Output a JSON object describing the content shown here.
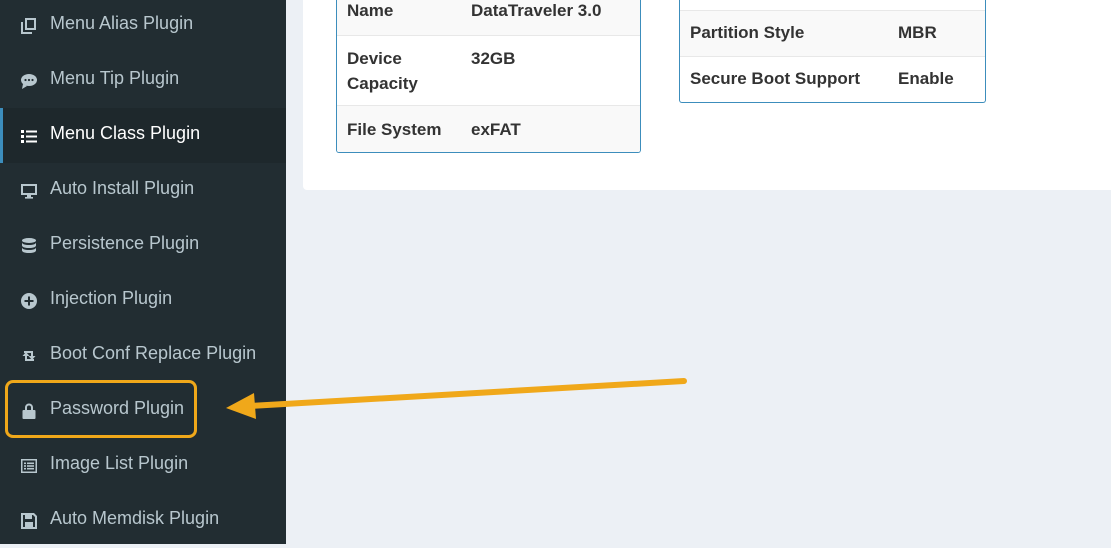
{
  "sidebar": {
    "items": [
      {
        "label": "Menu Alias Plugin",
        "icon": "copy-icon"
      },
      {
        "label": "Menu Tip Plugin",
        "icon": "comment-icon"
      },
      {
        "label": "Menu Class Plugin",
        "icon": "list-icon",
        "active": true
      },
      {
        "label": "Auto Install Plugin",
        "icon": "desktop-icon"
      },
      {
        "label": "Persistence Plugin",
        "icon": "database-icon"
      },
      {
        "label": "Injection Plugin",
        "icon": "plus-circle-icon"
      },
      {
        "label": "Boot Conf Replace Plugin",
        "icon": "retweet-icon"
      },
      {
        "label": "Password Plugin",
        "icon": "lock-icon",
        "highlighted": true
      },
      {
        "label": "Image List Plugin",
        "icon": "list-alt-icon"
      },
      {
        "label": "Auto Memdisk Plugin",
        "icon": "save-icon"
      }
    ]
  },
  "device_table": {
    "rows": [
      {
        "key": "Name",
        "value": "DataTraveler 3.0"
      },
      {
        "key": "Device Capacity",
        "value": "32GB"
      },
      {
        "key": "File System",
        "value": "exFAT"
      }
    ]
  },
  "boot_table": {
    "rows": [
      {
        "key": "Partition Style",
        "value": "MBR"
      },
      {
        "key": "Secure Boot Support",
        "value": "Enable"
      }
    ]
  },
  "colors": {
    "sidebar_bg": "#222d32",
    "sidebar_active_bg": "#1e282c",
    "sidebar_text": "#b8c7ce",
    "accent_border": "#3c8dbc",
    "annotation": "#f0a81a",
    "content_bg": "#ecf0f5"
  }
}
